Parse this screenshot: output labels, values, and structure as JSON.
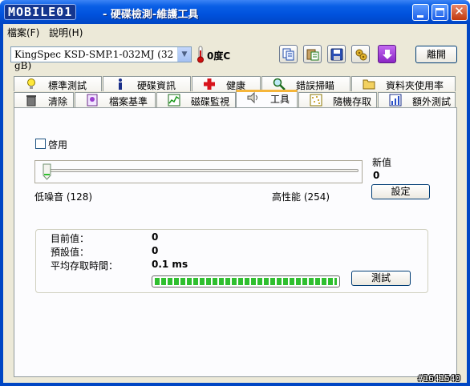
{
  "window": {
    "logo": "MOBILE01",
    "title": "- 硬碟檢測-維護工具"
  },
  "menu": {
    "file": "檔案(F)",
    "help": "說明(H)"
  },
  "toolbar": {
    "drive": "KingSpec KSD-SMP.1-032MJ (32 gB)",
    "temperature": "0度C",
    "exit_label": "離開",
    "icons": [
      "copy-icon",
      "paste-icon",
      "save-icon",
      "options-icon",
      "download-icon"
    ]
  },
  "tabs_row1": [
    {
      "label": "標準測試",
      "icon": "lightbulb-icon"
    },
    {
      "label": "硬碟資訊",
      "icon": "info-icon"
    },
    {
      "label": "健康",
      "icon": "health-cross-icon"
    },
    {
      "label": "錯誤掃瞄",
      "icon": "magnifier-icon"
    },
    {
      "label": "資料夾使用率",
      "icon": "folder-icon"
    }
  ],
  "tabs_row2": [
    {
      "label": "清除",
      "icon": "trash-icon"
    },
    {
      "label": "檔案基準",
      "icon": "file-benchmark-icon"
    },
    {
      "label": "磁碟監視",
      "icon": "monitor-icon"
    },
    {
      "label": "工具",
      "icon": "speaker-icon",
      "active": true
    },
    {
      "label": "隨機存取",
      "icon": "random-access-icon"
    },
    {
      "label": "額外測試",
      "icon": "extra-test-icon"
    }
  ],
  "aam": {
    "enable_label": "啓用",
    "enabled": false,
    "new_value_label": "新值",
    "new_value": "0",
    "set_label": "設定",
    "low_label": "低噪音 (128)",
    "high_label": "高性能 (254)",
    "slider_level": 0
  },
  "status": {
    "current_label": "目前值：",
    "current_value": "0",
    "default_label": "預設值：",
    "default_value": "0",
    "avg_access_label": "平均存取時間：",
    "avg_access_value": "0.1 ms",
    "progress": 1.0,
    "test_label": "測試"
  },
  "watermark": "#1641540"
}
